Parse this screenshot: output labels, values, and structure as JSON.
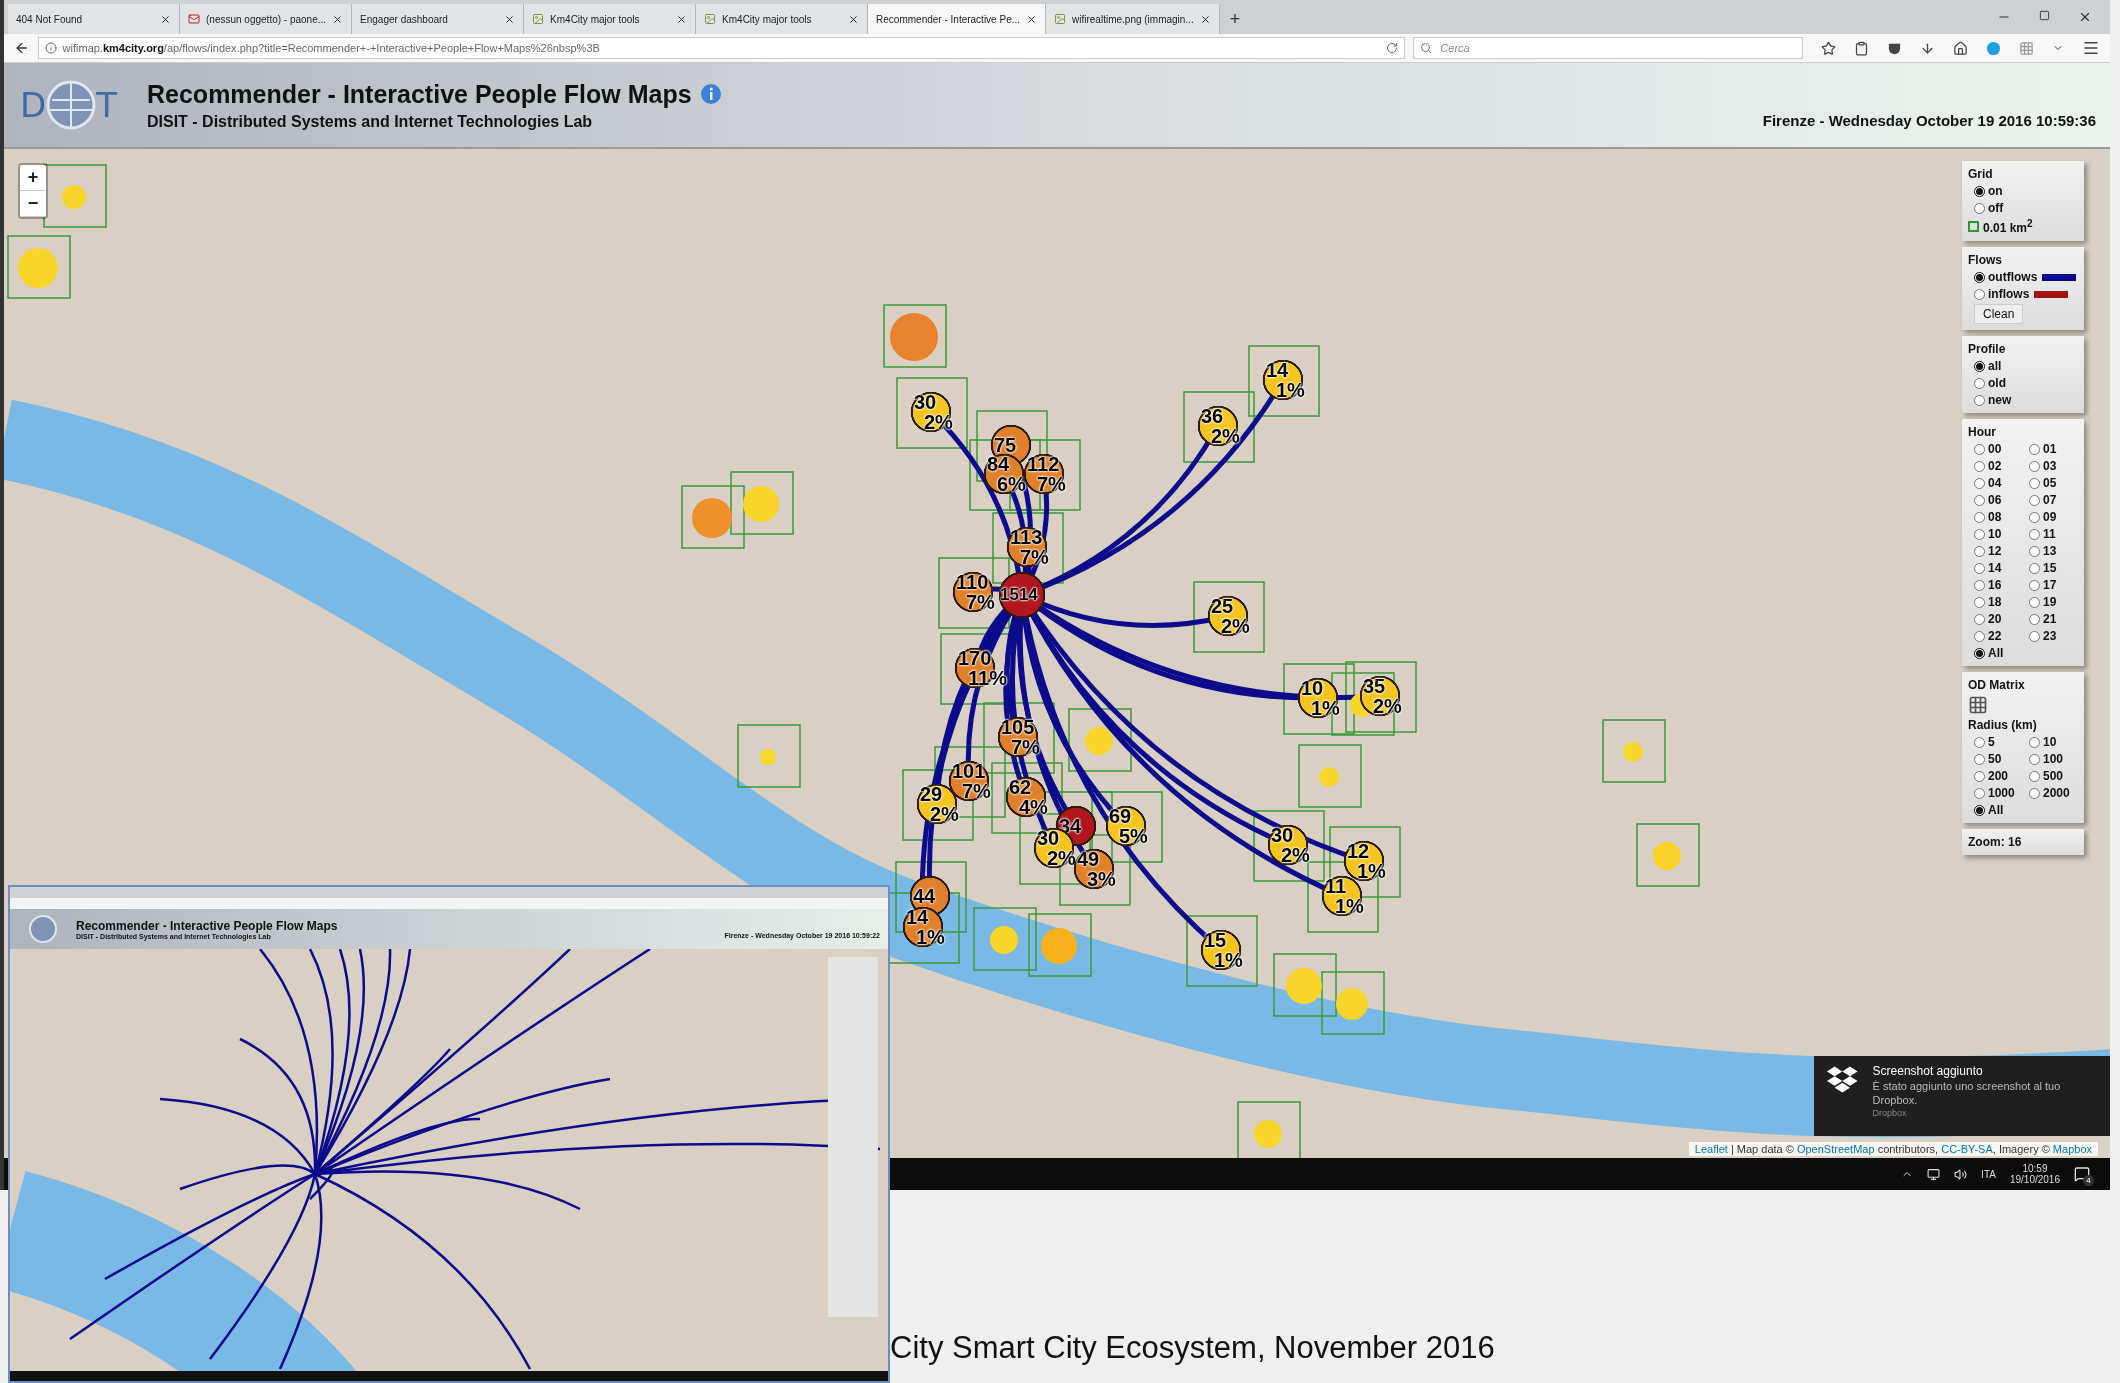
{
  "browser": {
    "tabs": [
      {
        "label": "404 Not Found",
        "kind": "plain",
        "selected": false
      },
      {
        "label": "(nessun oggetto) - paone...",
        "kind": "mail",
        "selected": false
      },
      {
        "label": "Engager dashboard",
        "kind": "plain",
        "selected": false
      },
      {
        "label": "Km4City major tools",
        "kind": "site",
        "selected": false
      },
      {
        "label": "Km4City major tools",
        "kind": "site",
        "selected": false
      },
      {
        "label": "Recommender - Interactive Pe...",
        "kind": "plain",
        "selected": true
      },
      {
        "label": "wifirealtime.png (immagin...",
        "kind": "site",
        "selected": false
      }
    ],
    "new_tab": "+",
    "url": "wifimap.**km4city.org**/ap/flows/index.php?title=Recommender+-+Interactive+People+Flow+Maps%26nbsp%3B",
    "search": {
      "placeholder": "Cerca"
    }
  },
  "header": {
    "logo_letters": [
      "D",
      "T"
    ],
    "title": "Recommender - Interactive People Flow Maps",
    "subtitle": "DISIT - Distributed Systems and Internet Technologies Lab",
    "datetime": "Firenze - Wednesday October 19 2016 10:59:36"
  },
  "map": {
    "zoom_in": "+",
    "zoom_out": "−",
    "markers": [
      {
        "kind": "destination",
        "value": "14",
        "percent": "1%",
        "color": "#f4c51e"
      },
      {
        "kind": "destination",
        "value": "30",
        "percent": "2%",
        "color": "#f4c51e"
      },
      {
        "kind": "destination",
        "value": "36",
        "percent": "2%",
        "color": "#f4c51e"
      },
      {
        "kind": "destination",
        "value": "75",
        "color": "#e0802a"
      },
      {
        "kind": "destination",
        "value": "84",
        "percent": "6%",
        "color": "#e0802a"
      },
      {
        "kind": "destination",
        "value": "112",
        "percent": "7%",
        "color": "#e0802a"
      },
      {
        "kind": "destination",
        "value": "113",
        "percent": "7%",
        "color": "#e0802a"
      },
      {
        "kind": "destination",
        "value": "110",
        "percent": "7%",
        "color": "#e0802a"
      },
      {
        "kind": "origin",
        "value": "1514",
        "color": "#b0161b"
      },
      {
        "kind": "destination",
        "value": "25",
        "percent": "2%",
        "color": "#f4c51e"
      },
      {
        "kind": "destination",
        "value": "170",
        "percent": "11%",
        "color": "#e0802a"
      },
      {
        "kind": "destination",
        "value": "10",
        "percent": "1%",
        "color": "#f4c51e"
      },
      {
        "kind": "destination",
        "value": "35",
        "percent": "2%",
        "color": "#f4c51e"
      },
      {
        "kind": "destination",
        "value": "105",
        "percent": "7%",
        "color": "#e0802a"
      },
      {
        "kind": "destination",
        "value": "29",
        "percent": "2%",
        "color": "#f4c51e"
      },
      {
        "kind": "destination",
        "value": "101",
        "percent": "7%",
        "color": "#e0802a"
      },
      {
        "kind": "destination",
        "value": "62",
        "percent": "4%",
        "color": "#e0802a"
      },
      {
        "kind": "destination",
        "value": "34",
        "color": "#b0161b"
      },
      {
        "kind": "destination",
        "value": "69",
        "percent": "5%",
        "color": "#f4c51e"
      },
      {
        "kind": "destination",
        "value": "30",
        "percent": "2%",
        "color": "#f4c51e"
      },
      {
        "kind": "destination",
        "value": "49",
        "percent": "3%",
        "color": "#e0802a"
      },
      {
        "kind": "destination",
        "value": "30",
        "percent": "2%",
        "color": "#f4c51e"
      },
      {
        "kind": "destination",
        "value": "12",
        "percent": "1%",
        "color": "#f4c51e"
      },
      {
        "kind": "destination",
        "value": "44",
        "color": "#e0802a"
      },
      {
        "kind": "destination",
        "value": "11",
        "percent": "1%",
        "color": "#f4c51e"
      },
      {
        "kind": "destination",
        "value": "14",
        "percent": "1%",
        "color": "#e0802a"
      },
      {
        "kind": "destination",
        "value": "15",
        "percent": "1%",
        "color": "#f4c51e"
      }
    ],
    "spots": [
      {
        "color": "#e8822c"
      },
      {
        "color": "#f0902a"
      },
      {
        "color": "#f7d52a"
      },
      {
        "color": "#f7d52a"
      },
      {
        "color": "#f7d52a"
      },
      {
        "color": "#f7d52a"
      },
      {
        "color": "#f7d52a"
      },
      {
        "color": "#f7d52a"
      },
      {
        "color": "#f7d52a"
      },
      {
        "color": "#f7d52a"
      },
      {
        "color": "#f5b21c"
      },
      {
        "color": "#f7d52a"
      },
      {
        "color": "#f7d52a"
      },
      {
        "color": "#f7d52a"
      },
      {
        "color": "#f7d52a"
      },
      {
        "color": "#f7d52a"
      }
    ],
    "attribution": [
      {
        "text": "Leaflet",
        "kind": "link"
      },
      {
        "text": " | Map data © ",
        "kind": "text"
      },
      {
        "text": "OpenStreetMap",
        "kind": "link"
      },
      {
        "text": " contributors, ",
        "kind": "text"
      },
      {
        "text": "CC-BY-SA",
        "kind": "link"
      },
      {
        "text": ", Imagery © ",
        "kind": "text"
      },
      {
        "text": "Mapbox",
        "kind": "link"
      }
    ]
  },
  "panel": {
    "grid": {
      "title": "Grid",
      "options": [
        {
          "label": "on",
          "selected": true
        },
        {
          "label": "off",
          "selected": false
        }
      ],
      "cell": "0.01 km$^{2}$"
    },
    "flows": {
      "title": "Flows",
      "options": [
        {
          "label": "outflows",
          "selected": true,
          "color": "#0a0a90"
        },
        {
          "label": "inflows",
          "selected": false,
          "color": "#a01414"
        }
      ],
      "clean": "Clean"
    },
    "profile": {
      "title": "Profile",
      "options": [
        {
          "label": "all",
          "selected": true
        },
        {
          "label": "old",
          "selected": false
        },
        {
          "label": "new",
          "selected": false
        }
      ]
    },
    "hour": {
      "title": "Hour",
      "options": [
        {
          "label": "00",
          "selected": false
        },
        {
          "label": "01",
          "selected": false
        },
        {
          "label": "02",
          "selected": false
        },
        {
          "label": "03",
          "selected": false
        },
        {
          "label": "04",
          "selected": false
        },
        {
          "label": "05",
          "selected": false
        },
        {
          "label": "06",
          "selected": false
        },
        {
          "label": "07",
          "selected": false
        },
        {
          "label": "08",
          "selected": false
        },
        {
          "label": "09",
          "selected": false
        },
        {
          "label": "10",
          "selected": false
        },
        {
          "label": "11",
          "selected": false
        },
        {
          "label": "12",
          "selected": false
        },
        {
          "label": "13",
          "selected": false
        },
        {
          "label": "14",
          "selected": false
        },
        {
          "label": "15",
          "selected": false
        },
        {
          "label": "16",
          "selected": false
        },
        {
          "label": "17",
          "selected": false
        },
        {
          "label": "18",
          "selected": false
        },
        {
          "label": "19",
          "selected": false
        },
        {
          "label": "20",
          "selected": false
        },
        {
          "label": "21",
          "selected": false
        },
        {
          "label": "22",
          "selected": false
        },
        {
          "label": "23",
          "selected": false
        },
        {
          "label": "All",
          "selected": true
        }
      ]
    },
    "od_matrix": "OD Matrix",
    "radius": {
      "title": "Radius (km)",
      "options": [
        {
          "label": "5",
          "selected": false
        },
        {
          "label": "10",
          "selected": false
        },
        {
          "label": "50",
          "selected": false
        },
        {
          "label": "100",
          "selected": false
        },
        {
          "label": "200",
          "selected": false
        },
        {
          "label": "500",
          "selected": false
        },
        {
          "label": "1000",
          "selected": false
        },
        {
          "label": "2000",
          "selected": false
        },
        {
          "label": "All",
          "selected": true
        }
      ]
    },
    "zoom": "Zoom: 16"
  },
  "toast": {
    "title": "Screenshot aggiunto",
    "message": "È stato aggiunto uno screenshot al tuo Dropbox.",
    "source": "Dropbox"
  },
  "taskbar": {
    "language": "ITA",
    "time": "10:59",
    "date": "19/10/2016",
    "notifications": "4"
  },
  "inset": {
    "title": "Recommender - Interactive People Flow Maps",
    "subtitle": "DISIT - Distributed Systems and Internet Technologies Lab",
    "datetime": "Firenze - Wednesday October 19 2016 10:59:22"
  },
  "caption": "City Smart City Ecosystem, November 2016"
}
